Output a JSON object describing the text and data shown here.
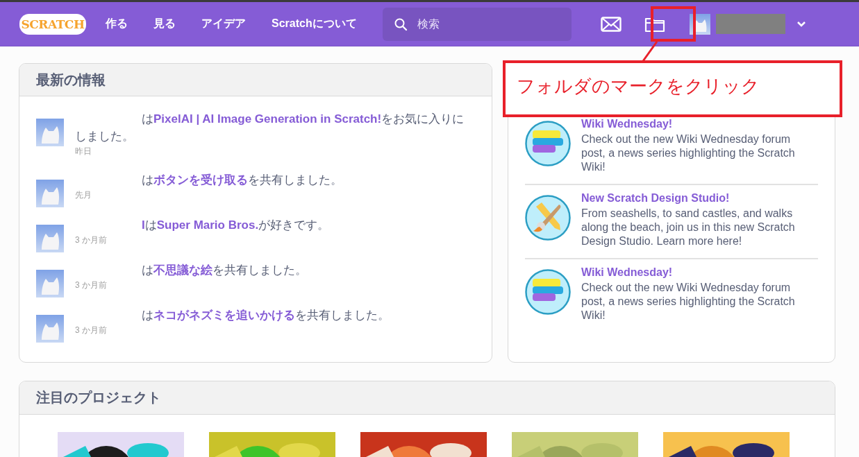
{
  "header": {
    "logo": "SCRATCH",
    "nav": [
      {
        "label": "作る"
      },
      {
        "label": "見る"
      },
      {
        "label": "アイデア"
      },
      {
        "label": "Scratchについて"
      }
    ],
    "search": {
      "placeholder": "検索"
    }
  },
  "annotation": {
    "callout": "フォルダのマークをクリック"
  },
  "activity": {
    "title": "最新の情報",
    "items": [
      {
        "parts": [
          {
            "kind": "plain",
            "text": "は"
          },
          {
            "kind": "link",
            "text": "PixelAI | AI Image Generation in Scratch!"
          },
          {
            "kind": "plain",
            "text": "をお気に入りにしました。"
          }
        ],
        "time": "昨日"
      },
      {
        "parts": [
          {
            "kind": "plain",
            "text": "は"
          },
          {
            "kind": "link",
            "text": "ボタンを受け取る"
          },
          {
            "kind": "plain",
            "text": "を共有しました。"
          }
        ],
        "time": "先月"
      },
      {
        "parts": [
          {
            "kind": "link",
            "text": "I"
          },
          {
            "kind": "plain",
            "text": "は"
          },
          {
            "kind": "link",
            "text": "Super Mario Bros."
          },
          {
            "kind": "plain",
            "text": "が好きです。"
          }
        ],
        "time": "3 か月前"
      },
      {
        "parts": [
          {
            "kind": "plain",
            "text": "は"
          },
          {
            "kind": "link",
            "text": "不思議な絵"
          },
          {
            "kind": "plain",
            "text": "を共有しました。"
          }
        ],
        "time": "3 か月前"
      },
      {
        "parts": [
          {
            "kind": "plain",
            "text": "は"
          },
          {
            "kind": "link",
            "text": "ネコがネズミを追いかける"
          },
          {
            "kind": "plain",
            "text": "を共有しました。"
          }
        ],
        "time": "3 か月前"
      }
    ]
  },
  "news": {
    "items": [
      {
        "kind": "blocks",
        "title": "Wiki Wednesday!",
        "body": "Check out the new Wiki Wednesday forum post, a news series highlighting the Scratch Wiki!"
      },
      {
        "kind": "brush",
        "title": "New Scratch Design Studio!",
        "body": "From seashells, to sand castles, and walks along the beach, join us in this new Scratch Design Studio. Learn more here!"
      },
      {
        "kind": "blocks",
        "title": "Wiki Wednesday!",
        "body": "Check out the new Wiki Wednesday forum post, a news series highlighting the Scratch Wiki!"
      }
    ]
  },
  "featured": {
    "title": "注目のプロジェクト"
  }
}
